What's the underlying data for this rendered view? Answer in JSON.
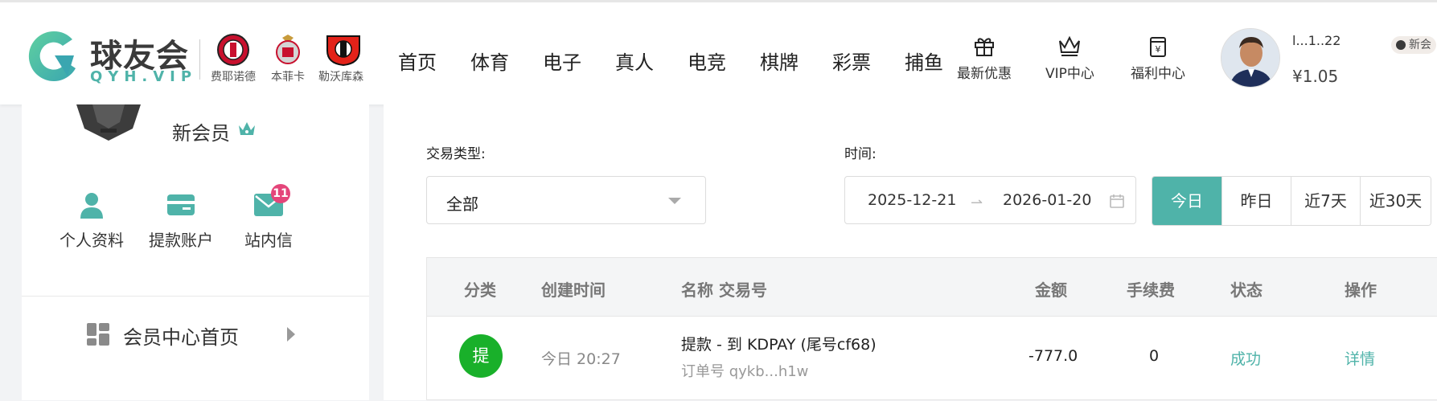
{
  "header": {
    "logo_text": "球友会",
    "logo_sub": "QYH.VIP",
    "clubs": [
      {
        "name": "费耶诺德",
        "icon": "feyenoord-crest-icon"
      },
      {
        "name": "本菲卡",
        "icon": "benfica-crest-icon"
      },
      {
        "name": "勒沃库森",
        "icon": "leverkusen-crest-icon"
      }
    ],
    "nav": [
      "首页",
      "体育",
      "电子",
      "真人",
      "电竞",
      "棋牌",
      "彩票",
      "捕鱼"
    ],
    "utilities": [
      {
        "label": "最新优惠",
        "icon": "gift-icon"
      },
      {
        "label": "VIP中心",
        "icon": "crown-icon"
      },
      {
        "label": "福利中心",
        "icon": "welfare-icon"
      }
    ],
    "user": {
      "name": "l...1..22",
      "badge": "新会",
      "balance": "¥1.05"
    }
  },
  "sidebar": {
    "member_title": "新会员",
    "links": [
      {
        "label": "个人资料",
        "icon": "user-icon"
      },
      {
        "label": "提款账户",
        "icon": "card-icon"
      },
      {
        "label": "站内信",
        "icon": "mail-icon",
        "badge": "11"
      }
    ],
    "home_label": "会员中心首页"
  },
  "filters": {
    "type_label": "交易类型:",
    "type_value": "全部",
    "time_label": "时间:",
    "date_start": "2025-12-21",
    "date_end": "2026-01-20",
    "quick": [
      "今日",
      "昨日",
      "近7天",
      "近30天"
    ],
    "active_quick": "今日"
  },
  "table": {
    "headers": [
      "分类",
      "创建时间",
      "名称 交易号",
      "金额",
      "手续费",
      "状态",
      "操作"
    ],
    "rows": [
      {
        "category": "提",
        "time": "今日 20:27",
        "name": "提款 - 到 KDPAY (尾号cf68)",
        "order": "订单号 qykb...h1w",
        "amount": "-777.0",
        "fee": "0",
        "status": "成功",
        "action": "详情"
      }
    ]
  },
  "colors": {
    "accent": "#4fb3a9",
    "success_badge": "#19b02a",
    "mail_badge": "#e4457a"
  }
}
